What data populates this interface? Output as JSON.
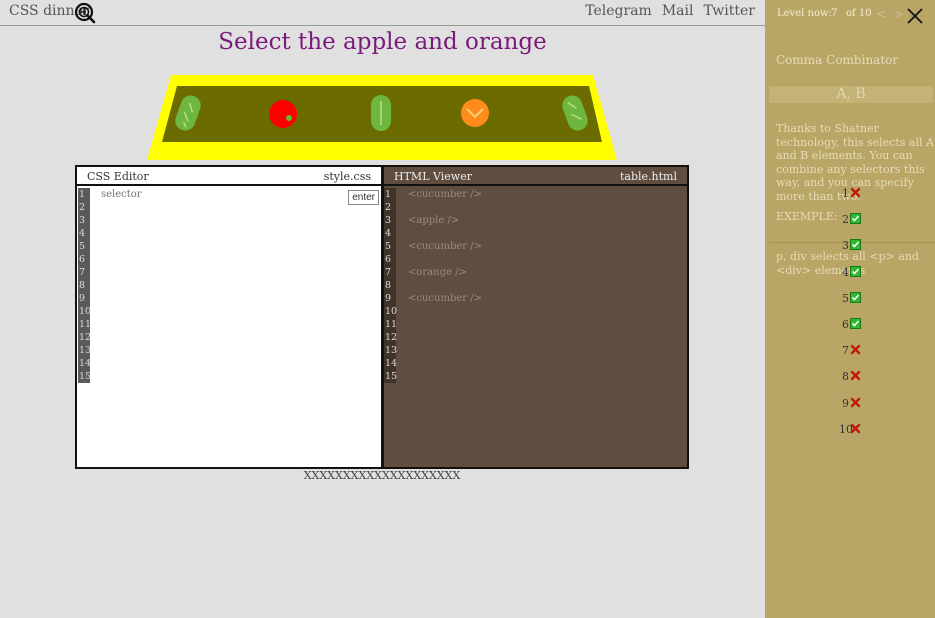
{
  "header": {
    "logo_text": "CSS dinner",
    "links": [
      "Telegram",
      "Mail",
      "Twitter"
    ]
  },
  "game": {
    "title": "Select the apple and orange",
    "caption": "XXXXXXXXXXXXXXXXXXXX",
    "plate_items": [
      "cucumber",
      "apple",
      "cucumber",
      "orange",
      "cucumber"
    ],
    "colors": {
      "table_rim": "#ffff00",
      "table_top": "#6b6b00",
      "cucumber": "#6fb640",
      "apple": "#ff0000",
      "orange": "#ff8c1a"
    }
  },
  "css_editor": {
    "title": "CSS Editor",
    "filename": "style.css",
    "placeholder": "selector",
    "enter_label": "enter",
    "line_numbers": [
      "1",
      "2",
      "3",
      "4",
      "5",
      "6",
      "7",
      "8",
      "9",
      "10",
      "11",
      "12",
      "13",
      "14",
      "15"
    ]
  },
  "html_viewer": {
    "title": "HTML Viewer",
    "filename": "table.html",
    "line_numbers": [
      "1",
      "2",
      "3",
      "4",
      "5",
      "6",
      "7",
      "8",
      "9",
      "10",
      "11",
      "12",
      "13",
      "14",
      "15"
    ],
    "lines": [
      "<cucumber />",
      "",
      "<apple />",
      "",
      "<cucumber />",
      "",
      "<orange />",
      "",
      "<cucumber />",
      "",
      "",
      "",
      "",
      "",
      ""
    ]
  },
  "sidebar": {
    "level_label": "Level now:",
    "level_current": "7",
    "level_total": "of 10",
    "prev": "<",
    "next": ">",
    "lesson_title": "Comma Combinator",
    "selector_name": "A, B",
    "description": "Thanks to Shatner technology, this selects all A and B elements. You can combine any selectors this way, and you can specify more than two.",
    "example_label": "EXEMPLE:",
    "example_text": "p, div selects all <p> and <div> elements",
    "levels": [
      {
        "n": "1",
        "done": false
      },
      {
        "n": "2",
        "done": true
      },
      {
        "n": "3",
        "done": true
      },
      {
        "n": "4",
        "done": true
      },
      {
        "n": "5",
        "done": true
      },
      {
        "n": "6",
        "done": true
      },
      {
        "n": "7",
        "done": false
      },
      {
        "n": "8",
        "done": false
      },
      {
        "n": "9",
        "done": false
      },
      {
        "n": "10",
        "done": false
      }
    ]
  }
}
